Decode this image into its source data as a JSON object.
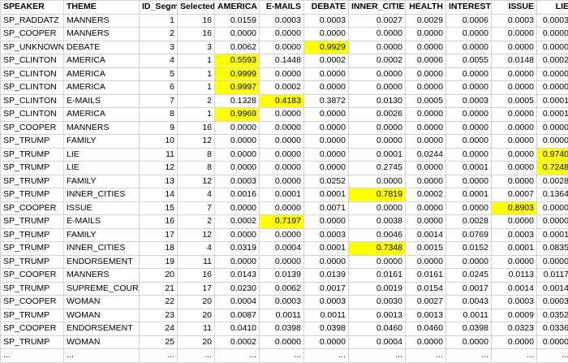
{
  "columns": [
    "SPEAKER",
    "THEME",
    "ID_Segm",
    "Selected",
    "AMERICA",
    "E-MAILS",
    "DEBATE",
    "INNER_CITIES",
    "HEALTH",
    "INTEREST",
    "ISSUE",
    "LIE",
    "..."
  ],
  "rows": [
    {
      "cells": [
        "SP_RADDATZ",
        "MANNERS",
        "1",
        "16",
        "0.0159",
        "0.0003",
        "0.0003",
        "0.0027",
        "0.0029",
        "0.0006",
        "0.0003",
        "0.0003",
        "..."
      ],
      "hl": []
    },
    {
      "cells": [
        "SP_COOPER",
        "MANNERS",
        "2",
        "16",
        "0.0000",
        "0.0000",
        "0.0000",
        "0.0000",
        "0.0000",
        "0.0000",
        "0.0000",
        "0.0000",
        "..."
      ],
      "hl": []
    },
    {
      "cells": [
        "SP_UNKNOWN",
        "DEBATE",
        "3",
        "3",
        "0.0062",
        "0.0000",
        "0.9929",
        "0.0000",
        "0.0000",
        "0.0000",
        "0.0000",
        "0.0000",
        "..."
      ],
      "hl": [
        6
      ]
    },
    {
      "cells": [
        "SP_CLINTON",
        "AMERICA",
        "4",
        "1",
        "0.5593",
        "0.1448",
        "0.0002",
        "0.0002",
        "0.0006",
        "0.0055",
        "0.0148",
        "0.0002",
        "..."
      ],
      "hl": [
        4
      ]
    },
    {
      "cells": [
        "SP_CLINTON",
        "AMERICA",
        "5",
        "1",
        "0.9999",
        "0.0000",
        "0.0000",
        "0.0000",
        "0.0000",
        "0.0000",
        "0.0000",
        "0.0000",
        "..."
      ],
      "hl": [
        4
      ]
    },
    {
      "cells": [
        "SP_CLINTON",
        "AMERICA",
        "6",
        "1",
        "0.9997",
        "0.0002",
        "0.0000",
        "0.0000",
        "0.0000",
        "0.0000",
        "0.0000",
        "0.0000",
        "..."
      ],
      "hl": [
        4
      ]
    },
    {
      "cells": [
        "SP_CLINTON",
        "E-MAILS",
        "7",
        "2",
        "0.1328",
        "0.4183",
        "0.3872",
        "0.0130",
        "0.0005",
        "0.0003",
        "0.0005",
        "0.0001",
        "..."
      ],
      "hl": [
        5
      ]
    },
    {
      "cells": [
        "SP_CLINTON",
        "AMERICA",
        "8",
        "1",
        "0.9969",
        "0.0000",
        "0.0000",
        "0.0026",
        "0.0000",
        "0.0000",
        "0.0000",
        "0.0001",
        "..."
      ],
      "hl": [
        4
      ]
    },
    {
      "cells": [
        "SP_COOPER",
        "MANNERS",
        "9",
        "16",
        "0.0000",
        "0.0000",
        "0.0000",
        "0.0000",
        "0.0000",
        "0.0000",
        "0.0000",
        "0.0000",
        "..."
      ],
      "hl": []
    },
    {
      "cells": [
        "SP_TRUMP",
        "FAMILY",
        "10",
        "12",
        "0.0000",
        "0.0000",
        "0.0000",
        "0.0000",
        "0.0000",
        "0.0000",
        "0.0000",
        "0.0000",
        "..."
      ],
      "hl": []
    },
    {
      "cells": [
        "SP_TRUMP",
        "LIE",
        "11",
        "8",
        "0.0000",
        "0.0000",
        "0.0000",
        "0.0001",
        "0.0244",
        "0.0000",
        "0.0000",
        "0.9740",
        "..."
      ],
      "hl": [
        11
      ]
    },
    {
      "cells": [
        "SP_TRUMP",
        "LIE",
        "12",
        "8",
        "0.0000",
        "0.0000",
        "0.0000",
        "0.2745",
        "0.0000",
        "0.0001",
        "0.0000",
        "0.7248",
        "..."
      ],
      "hl": [
        11
      ]
    },
    {
      "cells": [
        "SP_TRUMP",
        "FAMILY",
        "13",
        "12",
        "0.0003",
        "0.0000",
        "0.0252",
        "0.0000",
        "0.0000",
        "0.0000",
        "0.0000",
        "0.0028",
        "..."
      ],
      "hl": []
    },
    {
      "cells": [
        "SP_TRUMP",
        "INNER_CITIES",
        "14",
        "4",
        "0.0016",
        "0.0001",
        "0.0001",
        "0.7819",
        "0.0002",
        "0.0001",
        "0.0007",
        "0.1364",
        "..."
      ],
      "hl": [
        7
      ]
    },
    {
      "cells": [
        "SP_COOPER",
        "ISSUE",
        "15",
        "7",
        "0.0000",
        "0.0000",
        "0.0071",
        "0.0000",
        "0.0000",
        "0.0000",
        "0.8903",
        "0.0000",
        "..."
      ],
      "hl": [
        10
      ]
    },
    {
      "cells": [
        "SP_TRUMP",
        "E-MAILS",
        "16",
        "2",
        "0.0002",
        "0.7197",
        "0.0000",
        "0.0038",
        "0.0000",
        "0.0028",
        "0.0000",
        "0.0000",
        "..."
      ],
      "hl": [
        5
      ]
    },
    {
      "cells": [
        "SP_TRUMP",
        "FAMILY",
        "17",
        "12",
        "0.0000",
        "0.0000",
        "0.0003",
        "0.0046",
        "0.0014",
        "0.0769",
        "0.0003",
        "0.0001",
        "..."
      ],
      "hl": []
    },
    {
      "cells": [
        "SP_TRUMP",
        "INNER_CITIES",
        "18",
        "4",
        "0.0319",
        "0.0004",
        "0.0001",
        "0.7348",
        "0.0015",
        "0.0152",
        "0.0001",
        "0.0835",
        "..."
      ],
      "hl": [
        7
      ]
    },
    {
      "cells": [
        "SP_TRUMP",
        "ENDORSEMENT",
        "19",
        "11",
        "0.0000",
        "0.0000",
        "0.0000",
        "0.0000",
        "0.0000",
        "0.0000",
        "0.0000",
        "0.0000",
        "..."
      ],
      "hl": []
    },
    {
      "cells": [
        "SP_COOPER",
        "MANNERS",
        "20",
        "16",
        "0.0143",
        "0.0139",
        "0.0139",
        "0.0161",
        "0.0161",
        "0.0245",
        "0.0113",
        "0.0117",
        "..."
      ],
      "hl": []
    },
    {
      "cells": [
        "SP_TRUMP",
        "SUPREME_COURT",
        "21",
        "17",
        "0.0230",
        "0.0062",
        "0.0017",
        "0.0019",
        "0.0154",
        "0.0017",
        "0.0014",
        "0.0014",
        "..."
      ],
      "hl": []
    },
    {
      "cells": [
        "SP_COOPER",
        "WOMAN",
        "22",
        "20",
        "0.0004",
        "0.0003",
        "0.0003",
        "0.0030",
        "0.0027",
        "0.0043",
        "0.0003",
        "0.0003",
        "..."
      ],
      "hl": []
    },
    {
      "cells": [
        "SP_TRUMP",
        "WOMAN",
        "23",
        "20",
        "0.0087",
        "0.0011",
        "0.0011",
        "0.0013",
        "0.0013",
        "0.0011",
        "0.0009",
        "0.0352",
        "..."
      ],
      "hl": []
    },
    {
      "cells": [
        "SP_COOPER",
        "ENDORSEMENT",
        "24",
        "11",
        "0.0410",
        "0.0398",
        "0.0398",
        "0.0460",
        "0.0460",
        "0.0398",
        "0.0323",
        "0.0336",
        "..."
      ],
      "hl": []
    },
    {
      "cells": [
        "SP_TRUMP",
        "WOMAN",
        "25",
        "20",
        "0.0002",
        "0.0000",
        "0.0000",
        "0.0004",
        "0.0000",
        "0.0000",
        "0.0000",
        "0.0000",
        "..."
      ],
      "hl": []
    },
    {
      "cells": [
        "...",
        "...",
        "...",
        "...",
        "...",
        "...",
        "...",
        "...",
        "...",
        "...",
        "...",
        "...",
        "..."
      ],
      "hl": []
    }
  ],
  "highlight_color": "#ffff00"
}
